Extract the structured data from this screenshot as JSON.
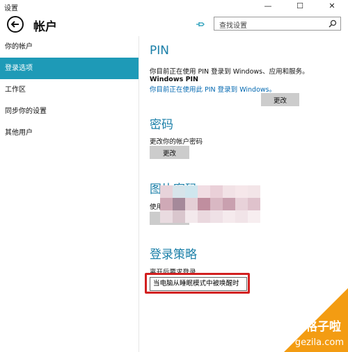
{
  "window": {
    "title": "设置",
    "minimize": "—",
    "maximize": "☐",
    "close": "✕"
  },
  "header": {
    "title": "帐户"
  },
  "search": {
    "placeholder": "查找设置"
  },
  "sidebar": {
    "items": [
      {
        "label": "你的帐户"
      },
      {
        "label": "登录选项",
        "active": true
      },
      {
        "label": "工作区"
      },
      {
        "label": "同步你的设置"
      },
      {
        "label": "其他用户"
      }
    ]
  },
  "pin": {
    "title": "PIN",
    "desc": "你目前正在使用 PIN 登录到 Windows、应用和服务。",
    "subheading": "Windows PIN",
    "link": "你目前正在使用此 PIN 登录到 Windows。",
    "button": "更改"
  },
  "password": {
    "title": "密码",
    "desc": "更改你的帐户密码",
    "button": "更改"
  },
  "picture_password": {
    "title": "图片密码",
    "desc": "使用",
    "button": "添"
  },
  "sign_in_policy": {
    "title": "登录策略",
    "desc": "离开后要求登录",
    "selected": "当电脑从睡眠模式中被唤醒时"
  },
  "watermark": {
    "line1": "格子啦",
    "line2": "gezila.com"
  },
  "colors": {
    "accent": "#1e9ab7",
    "section_title": "#1a7fa8",
    "highlight_box": "#d21f1f",
    "watermark": "#f39c12"
  }
}
